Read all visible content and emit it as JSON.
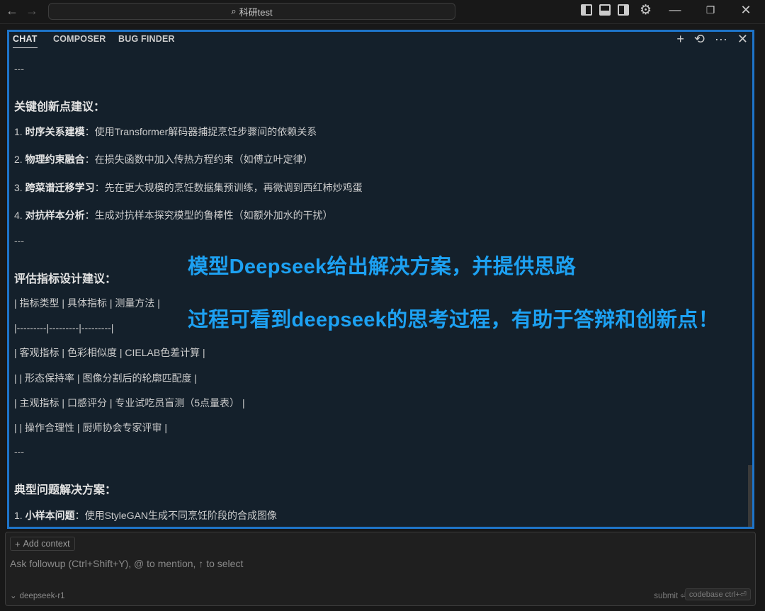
{
  "titlebar": {
    "back_icon": "←",
    "forward_icon": "→",
    "search_icon": "⌕",
    "title": "科研test",
    "settings_icon": "⚙",
    "minimize_icon": "—",
    "restore_icon": "❐",
    "close_icon": "✕"
  },
  "tabs": [
    "CHAT",
    "COMPOSER",
    "BUG FINDER"
  ],
  "panel_actions": {
    "new": "+",
    "history": "⟲",
    "more": "···",
    "close": "✕"
  },
  "content": {
    "sep1": "---",
    "heading1": "关键创新点建议：",
    "items1": [
      {
        "num": "1. ",
        "title": "时序关系建模",
        "text": "：使用Transformer解码器捕捉烹饪步骤间的依赖关系"
      },
      {
        "num": "2. ",
        "title": "物理约束融合",
        "text": "：在损失函数中加入传热方程约束（如傅立叶定律）"
      },
      {
        "num": "3. ",
        "title": "跨菜谱迁移学习",
        "text": "：先在更大规模的烹饪数据集预训练，再微调到西红柿炒鸡蛋"
      },
      {
        "num": "4. ",
        "title": "对抗样本分析",
        "text": "：生成对抗样本探究模型的鲁棒性（如额外加水的干扰）"
      }
    ],
    "sep2": "---",
    "heading2": "评估指标设计建议：",
    "table_lines": [
      "| 指标类型 | 具体指标 | 测量方法 |",
      "|---------|---------|---------|",
      "| 客观指标 | 色彩相似度 | CIELAB色差计算 |",
      "| | 形态保持率 | 图像分割后的轮廓匹配度 |",
      "| 主观指标 | 口感评分 | 专业试吃员盲测（5点量表） |",
      "| | 操作合理性 | 厨师协会专家评审 |"
    ],
    "sep3": "---",
    "heading3": "典型问题解决方案：",
    "items3": [
      {
        "num": "1. ",
        "title": "小样本问题",
        "text": "：使用StyleGAN生成不同烹饪阶段的合成图像"
      }
    ]
  },
  "overlay": {
    "line1": "模型Deepseek给出解决方案，并提供思路",
    "line2": "过程可看到deepseek的思考过程，有助于答辩和创新点！"
  },
  "input": {
    "add_context": "Add context",
    "placeholder": "Ask followup (Ctrl+Shift+Y), @ to mention, ↑ to select",
    "model": "deepseek-r1",
    "submit": "submit ⏎",
    "codebase": "codebase ctrl+⏎"
  },
  "colors": {
    "accent_border": "#1e74c8",
    "overlay_text": "#1da1f2",
    "panel_bg": "#14202b"
  }
}
